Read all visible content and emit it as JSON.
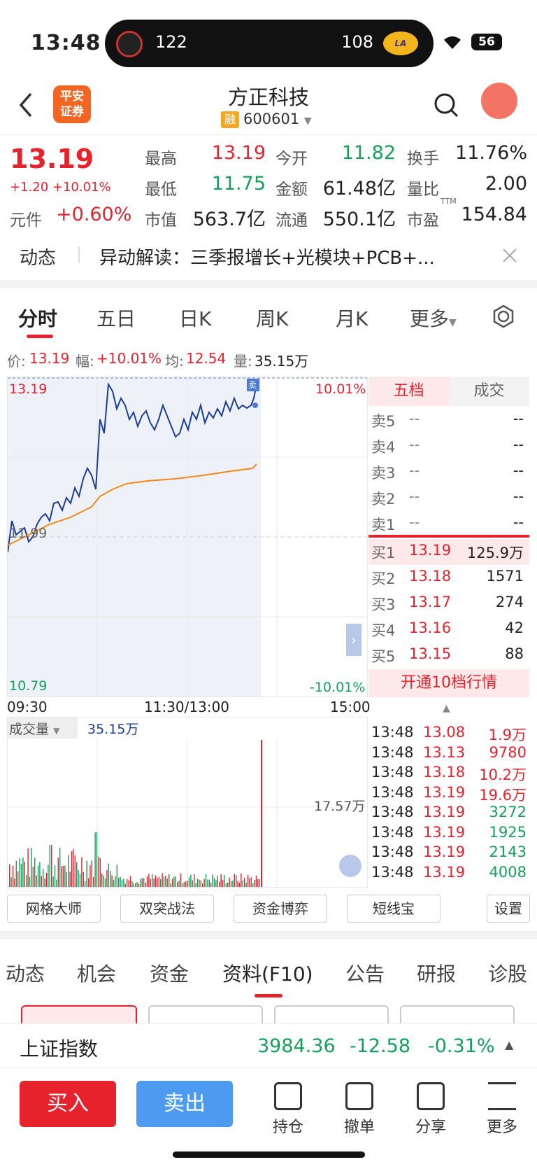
{
  "status": {
    "time": "13:48",
    "team1_score": "122",
    "team2_score": "108",
    "battery": "56"
  },
  "header": {
    "stock_name": "方正科技",
    "rong_badge": "融",
    "code": "600601",
    "logo_text": "平安证券"
  },
  "quote": {
    "price": "13.19",
    "change": "+1.20 +10.01%",
    "yuanjian_label": "元件",
    "yuanjian_value": "+0.60%",
    "high_label": "最高",
    "high": "13.19",
    "low_label": "最低",
    "low": "11.75",
    "mktcap_label": "市值",
    "mktcap": "563.7亿",
    "open_label": "今开",
    "open": "11.82",
    "amount_label": "金额",
    "amount": "61.48亿",
    "float_label": "流通",
    "float": "550.1亿",
    "turnover_label": "换手",
    "turnover": "11.76%",
    "volratio_label": "量比",
    "volratio": "2.00",
    "pe_label": "市盈",
    "pe_ttm": "TTM",
    "pe": "154.84"
  },
  "news": {
    "label": "动态",
    "text": "异动解读：三季报增长+光模块+PCB+..."
  },
  "tabs": [
    "分时",
    "五日",
    "日K",
    "周K",
    "月K",
    "更多"
  ],
  "infoline": {
    "price_label": "价:",
    "price": "13.19",
    "amp_label": "幅:",
    "amp": "+10.01%",
    "avg_label": "均:",
    "avg": "12.54",
    "vol_label": "量:",
    "vol": "35.15万"
  },
  "chart": {
    "top_price": "13.19",
    "top_pct": "10.01%",
    "mid_price": "11.99",
    "bottom_price": "10.79",
    "bottom_pct": "-10.01%",
    "t_start": "09:30",
    "t_mid": "11:30/13:00",
    "t_end": "15:00",
    "sell_marker": "卖"
  },
  "volume": {
    "label": "成交量",
    "value": "35.15万",
    "axis": "17.57万"
  },
  "orderbook": {
    "tab_wudang": "五档",
    "tab_chengjiao": "成交",
    "asks": [
      {
        "label": "卖5",
        "price": "--",
        "vol": "--"
      },
      {
        "label": "卖4",
        "price": "--",
        "vol": "--"
      },
      {
        "label": "卖3",
        "price": "--",
        "vol": "--"
      },
      {
        "label": "卖2",
        "price": "--",
        "vol": "--"
      },
      {
        "label": "卖1",
        "price": "--",
        "vol": "--"
      }
    ],
    "bids": [
      {
        "label": "买1",
        "price": "13.19",
        "vol": "125.9万"
      },
      {
        "label": "买2",
        "price": "13.18",
        "vol": "1571"
      },
      {
        "label": "买3",
        "price": "13.17",
        "vol": "274"
      },
      {
        "label": "买4",
        "price": "13.16",
        "vol": "42"
      },
      {
        "label": "买5",
        "price": "13.15",
        "vol": "88"
      }
    ],
    "open10": "开通10档行情"
  },
  "trades": [
    {
      "t": "13:48",
      "p": "13.08",
      "v": "1.9万",
      "vc": "red"
    },
    {
      "t": "13:48",
      "p": "13.13",
      "v": "9780",
      "vc": "red"
    },
    {
      "t": "13:48",
      "p": "13.18",
      "v": "10.2万",
      "vc": "red"
    },
    {
      "t": "13:48",
      "p": "13.19",
      "v": "19.6万",
      "vc": "red"
    },
    {
      "t": "13:48",
      "p": "13.19",
      "v": "3272",
      "vc": "green"
    },
    {
      "t": "13:48",
      "p": "13.19",
      "v": "1925",
      "vc": "green"
    },
    {
      "t": "13:48",
      "p": "13.19",
      "v": "2143",
      "vc": "green"
    },
    {
      "t": "13:48",
      "p": "13.19",
      "v": "4008",
      "vc": "green"
    }
  ],
  "tools": [
    "网格大师",
    "双突战法",
    "资金博弈",
    "短线宝",
    "设置"
  ],
  "ftabs": [
    "动态",
    "机会",
    "资金",
    "资料(F10)",
    "公告",
    "研报",
    "诊股"
  ],
  "index": {
    "name": "上证指数",
    "value": "3984.36",
    "change": "-12.58",
    "pct": "-0.31%"
  },
  "bottom": {
    "buy": "买入",
    "sell": "卖出",
    "hold": "持仓",
    "cancel": "撤单",
    "share": "分享",
    "more": "更多"
  }
}
